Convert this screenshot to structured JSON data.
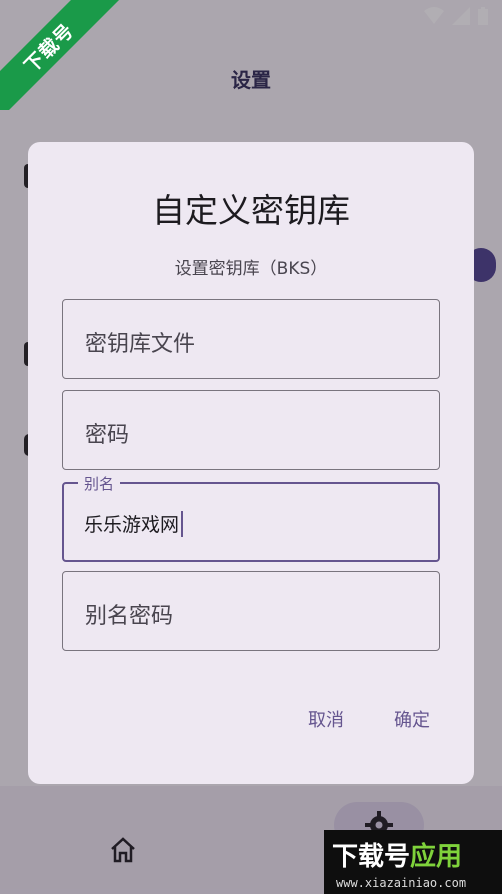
{
  "app": {
    "title": "设置"
  },
  "dialog": {
    "title": "自定义密钥库",
    "subtitle": "设置密钥库（BKS）",
    "fields": {
      "keystore_file": {
        "placeholder": "密钥库文件"
      },
      "password": {
        "placeholder": "密码"
      },
      "alias": {
        "label": "别名",
        "value": "乐乐游戏网"
      },
      "alias_password": {
        "placeholder": "别名密码"
      }
    },
    "actions": {
      "cancel": "取消",
      "confirm": "确定"
    }
  },
  "watermark": {
    "banner": "下载号",
    "badge_title_1": "下载号",
    "badge_title_2": "应用",
    "badge_url": "www.xiazainiao.com"
  },
  "colors": {
    "accent": "#65558f",
    "banner": "#1a9a49",
    "dialog": "#eee8f2"
  }
}
